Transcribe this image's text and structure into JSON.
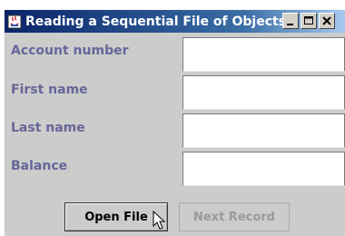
{
  "window": {
    "title": "Reading a Sequential File of Objects",
    "controls": [
      "minimize",
      "maximize",
      "close"
    ]
  },
  "form": {
    "fields": [
      {
        "label": "Account number",
        "value": ""
      },
      {
        "label": "First name",
        "value": ""
      },
      {
        "label": "Last name",
        "value": ""
      },
      {
        "label": "Balance",
        "value": ""
      }
    ]
  },
  "buttons": {
    "open_file": "Open File",
    "next_record": "Next Record"
  },
  "colors": {
    "label": "#666699",
    "titlebar_start": "#0a246a",
    "disabled_text": "#9a9a9a"
  },
  "icons": [
    "java-app-icon",
    "minimize-icon",
    "maximize-icon",
    "close-icon",
    "mouse-pointer-icon"
  ]
}
